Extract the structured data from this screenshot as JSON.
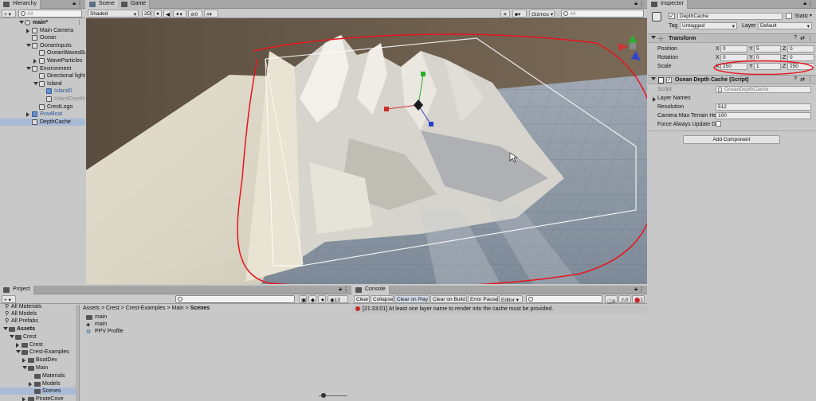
{
  "hierarchy": {
    "tab": "Hierarchy",
    "add_label": "+",
    "search_placeholder": "All",
    "items": [
      {
        "label": "main*",
        "depth": 0,
        "fold": "open",
        "icon": "scene-icon"
      },
      {
        "label": "Main Camera",
        "depth": 1,
        "fold": "closed",
        "icon": "cube-icon"
      },
      {
        "label": "Ocean",
        "depth": 1,
        "fold": "none",
        "icon": "cube-icon"
      },
      {
        "label": "OceanInputs",
        "depth": 1,
        "fold": "open",
        "icon": "cube-icon"
      },
      {
        "label": "OceanWavesBatch",
        "depth": 2,
        "fold": "none",
        "icon": "cube-icon"
      },
      {
        "label": "WaveParticles",
        "depth": 2,
        "fold": "closed",
        "icon": "cube-icon"
      },
      {
        "label": "Environment",
        "depth": 1,
        "fold": "open",
        "icon": "cube-icon"
      },
      {
        "label": "Directional light",
        "depth": 2,
        "fold": "none",
        "icon": "cube-icon"
      },
      {
        "label": "Island",
        "depth": 2,
        "fold": "open",
        "icon": "cube-icon"
      },
      {
        "label": "Island0",
        "depth": 3,
        "fold": "none",
        "icon": "prefab-icon",
        "color": "#2f5d9e"
      },
      {
        "label": "IslandDepthCact",
        "depth": 3,
        "fold": "none",
        "icon": "cube-icon",
        "color": "#8a8a8a"
      },
      {
        "label": "CrestLogo",
        "depth": 2,
        "fold": "none",
        "icon": "cube-icon"
      },
      {
        "label": "RowBoat",
        "depth": 1,
        "fold": "closed",
        "icon": "prefab-icon",
        "color": "#2f5d9e"
      },
      {
        "label": "DepthCache",
        "depth": 1,
        "fold": "none",
        "icon": "cube-icon",
        "selected": true
      }
    ]
  },
  "scene": {
    "tabs": [
      "Scene",
      "Game"
    ],
    "shading": "Shaded",
    "mode_2d": "2D",
    "hidden_count": "0",
    "gizmos": "Gizmos",
    "search_placeholder": "All"
  },
  "project": {
    "tab": "Project",
    "add_label": "+",
    "badge_count": "13",
    "favorites": [
      "All Materials",
      "All Models",
      "All Prefabs"
    ],
    "tree": [
      {
        "label": "Assets",
        "depth": 0,
        "fold": "open",
        "bold": true
      },
      {
        "label": "Crest",
        "depth": 1,
        "fold": "open"
      },
      {
        "label": "Crest",
        "depth": 2,
        "fold": "closed"
      },
      {
        "label": "Crest-Examples",
        "depth": 2,
        "fold": "open"
      },
      {
        "label": "BoatDev",
        "depth": 3,
        "fold": "closed"
      },
      {
        "label": "Main",
        "depth": 3,
        "fold": "open"
      },
      {
        "label": "Materials",
        "depth": 4,
        "fold": "none"
      },
      {
        "label": "Models",
        "depth": 4,
        "fold": "closed"
      },
      {
        "label": "Scenes",
        "depth": 4,
        "fold": "none",
        "selected": true
      },
      {
        "label": "PirateCove",
        "depth": 3,
        "fold": "closed"
      },
      {
        "label": "Shared",
        "depth": 3,
        "fold": "closed"
      }
    ],
    "breadcrumb": [
      "Assets",
      "Crest",
      "Crest-Examples",
      "Main",
      "Scenes"
    ],
    "files": [
      {
        "label": "main",
        "icon": "folder-icon"
      },
      {
        "label": "main",
        "icon": "unity-scene-icon"
      },
      {
        "label": "PPV Profile",
        "icon": "asset-icon"
      }
    ]
  },
  "console": {
    "tab": "Console",
    "buttons": [
      "Clear",
      "Collapse",
      "Clear on Play",
      "Clear on Build",
      "Error Pause",
      "Editor"
    ],
    "info_count": "0",
    "warn_count": "0",
    "error_count": "1",
    "message": "[21:33:01] At least one layer name to render into the cache must be provided."
  },
  "inspector": {
    "tab": "Inspector",
    "object_name": "DepthCache",
    "static_label": "Static",
    "tag_label": "Tag",
    "tag_value": "Untagged",
    "layer_label": "Layer",
    "layer_value": "Default",
    "transform": {
      "title": "Transform",
      "rows": [
        {
          "label": "Position",
          "x": "0",
          "y": "5",
          "z": "0"
        },
        {
          "label": "Rotation",
          "x": "0",
          "y": "0",
          "z": "0"
        },
        {
          "label": "Scale",
          "x": "250",
          "y": "1",
          "z": "250"
        }
      ]
    },
    "script_component": {
      "title": "Ocean Depth Cache (Script)",
      "script_label": "Script",
      "script_value": "OceanDepthCache",
      "layer_names_label": "Layer Names",
      "resolution_label": "Resolution",
      "resolution_value": "512",
      "camera_label": "Camera Max Terrain He",
      "camera_value": "100",
      "force_label": "Force Always Update De"
    },
    "add_component": "Add Component"
  },
  "colors": {
    "annotation": "#e8141e",
    "selection": "#a8bad6",
    "error": "#c62828"
  }
}
